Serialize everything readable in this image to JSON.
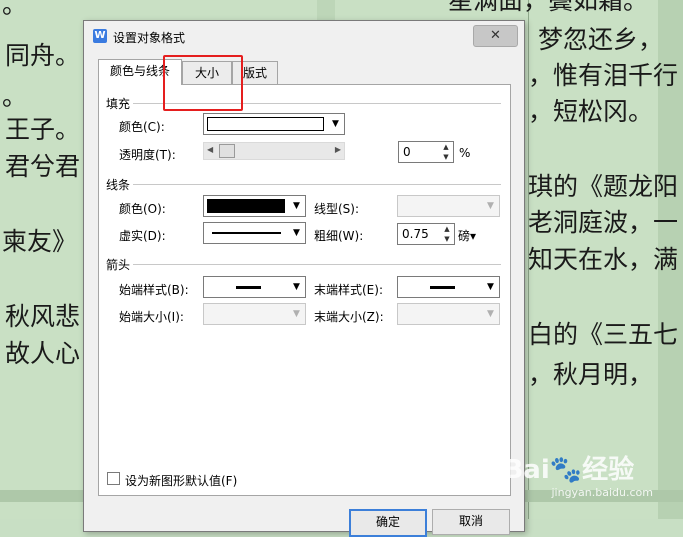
{
  "background": {
    "left_lines": [
      "。",
      "同舟。",
      "。",
      "王子。",
      "君兮君",
      "柬友》",
      "秋风悲",
      "故人心"
    ],
    "right_lines": [
      "星满面，鬓如霜。",
      "梦忽还乡，",
      "，惟有泪千行",
      "，短松冈。",
      "琪的《题龙阳",
      "老洞庭波，一",
      "知天在水，满",
      "白的《三五七",
      "，秋月明，"
    ]
  },
  "dialog": {
    "icon_glyph": "W",
    "title": "设置对象格式",
    "close_glyph": "✕",
    "tabs": [
      "颜色与线条",
      "大小",
      "版式"
    ],
    "fill": {
      "section": "填充",
      "color_label": "颜色(C):",
      "transparency_label": "透明度(T):",
      "transparency_value": "0",
      "transparency_unit": "%"
    },
    "line": {
      "section": "线条",
      "color_label": "颜色(O):",
      "style_label": "线型(S):",
      "dash_label": "虚实(D):",
      "weight_label": "粗细(W):",
      "weight_value": "0.75",
      "weight_unit": "磅▾"
    },
    "arrows": {
      "section": "箭头",
      "begin_style_label": "始端样式(B):",
      "end_style_label": "末端样式(E):",
      "begin_size_label": "始端大小(I):",
      "end_size_label": "末端大小(Z):"
    },
    "default_checkbox_label": "设为新图形默认值(F)",
    "ok_label": "确定",
    "cancel_label": "取消"
  },
  "watermark": {
    "logo": "Bai🐾经验",
    "site": "jingyan.baidu.com"
  }
}
